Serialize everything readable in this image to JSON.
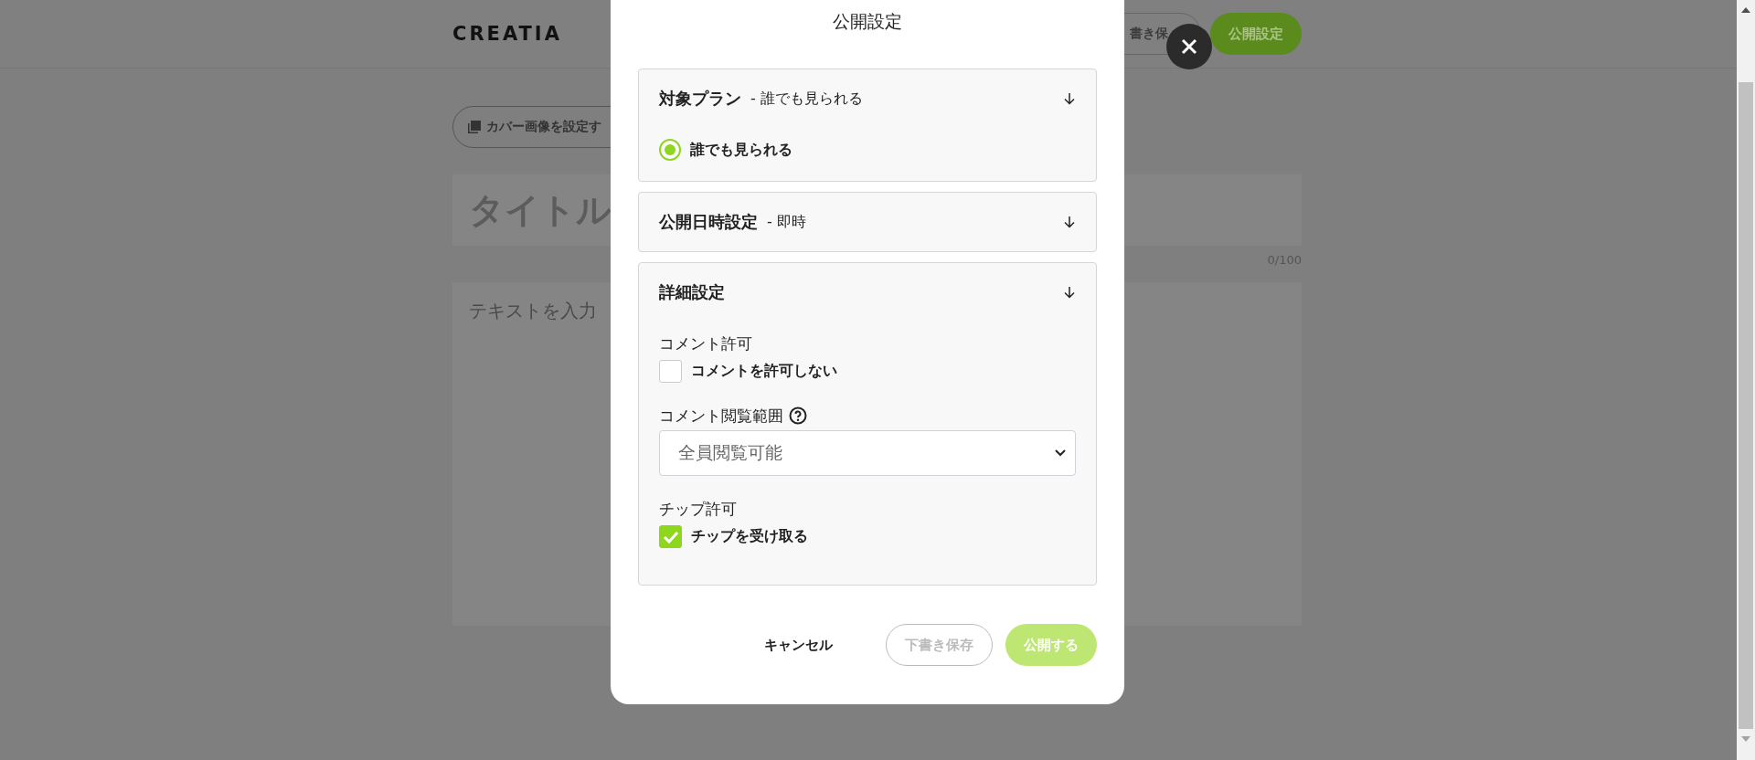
{
  "header": {
    "logo": "CREATIA",
    "buttons": [
      {
        "label": "書き保",
        "kind": "outline"
      },
      {
        "label": "公開設定",
        "kind": "primary"
      }
    ]
  },
  "editor": {
    "cover_button": "カバー画像を設定す",
    "title_placeholder": "タイトル",
    "counter": "0/100",
    "body_placeholder": "テキストを入力"
  },
  "modal": {
    "title": "公開設定",
    "sections": [
      {
        "title": "対象プラン",
        "summary": "- 誰でも見られる",
        "expanded": true,
        "kind": "radio",
        "options": [
          {
            "label": "誰でも見られる",
            "selected": true
          }
        ]
      },
      {
        "title": "公開日時設定",
        "summary": "- 即時",
        "expanded": false,
        "kind": "radio"
      },
      {
        "title": "詳細設定",
        "expanded": true,
        "kind": "settings",
        "fields": [
          {
            "kind": "checkbox",
            "label": "コメント許可",
            "option": "コメントを許可しない",
            "checked": false
          },
          {
            "kind": "select",
            "label": "コメント閲覧範囲",
            "help": true,
            "value": "全員閲覧可能"
          },
          {
            "kind": "checkbox",
            "label": "チップ許可",
            "option": "チップを受け取る",
            "checked": true
          }
        ]
      }
    ],
    "buttons": [
      {
        "label": "キャンセル",
        "kind": "text"
      },
      {
        "label": "下書き保存",
        "kind": "outline"
      },
      {
        "label": "公開する",
        "kind": "primary"
      }
    ]
  }
}
